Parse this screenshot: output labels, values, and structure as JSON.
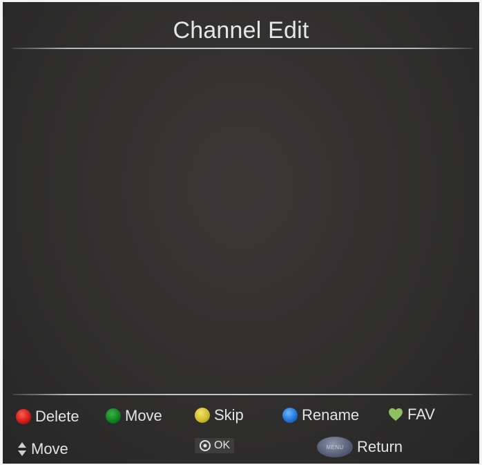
{
  "header": {
    "title": "Channel Edit"
  },
  "colors": {
    "red": "#d1231b",
    "green": "#119227",
    "yellow": "#d9c433",
    "blue": "#2a7de0",
    "fav": "#8dc061"
  },
  "legend": {
    "row1": [
      {
        "color": "red",
        "label": "Delete"
      },
      {
        "color": "green",
        "label": "Move"
      },
      {
        "color": "yellow",
        "label": "Skip"
      },
      {
        "color": "blue",
        "label": "Rename"
      },
      {
        "icon": "heart-icon",
        "label": "FAV"
      }
    ],
    "row2": {
      "move": {
        "icon": "up-down-arrow-icon",
        "label": "Move"
      },
      "ok": {
        "icon": "ok-circle-icon",
        "label": "OK"
      },
      "return": {
        "icon": "menu-button-icon",
        "button_text": "MENU",
        "label": "Return"
      }
    }
  }
}
